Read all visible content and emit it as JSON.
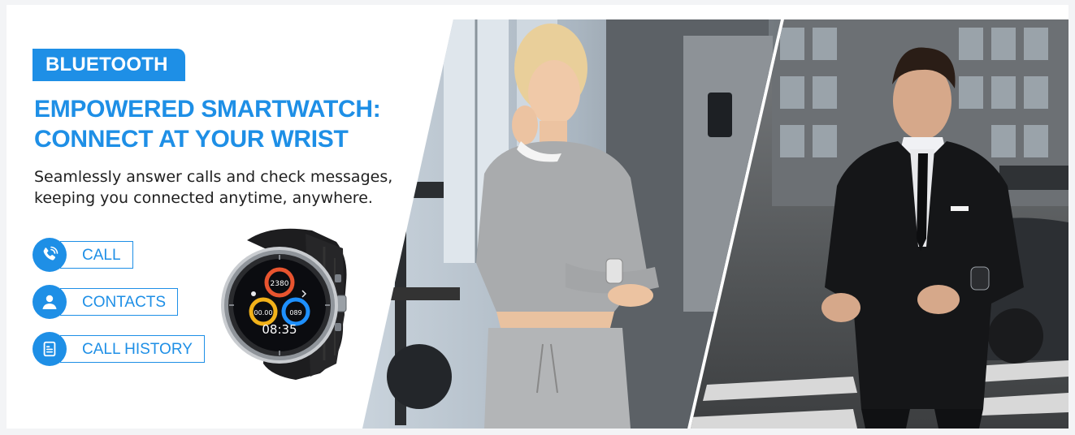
{
  "badge": {
    "label": "BLUETOOTH"
  },
  "headline": {
    "line1": "EMPOWERED SMARTWATCH:",
    "line2": "CONNECT AT YOUR WRIST"
  },
  "subtitle": {
    "line1": "Seamlessly answer calls and check messages,",
    "line2": "keeping you connected anytime, anywhere."
  },
  "features": [
    {
      "label": "CALL",
      "icon": "phone-icon"
    },
    {
      "label": "CONTACTS",
      "icon": "person-icon"
    },
    {
      "label": "CALL HISTORY",
      "icon": "document-icon"
    }
  ],
  "watch_face": {
    "steps": "2380",
    "heart": "089",
    "time": "08:35",
    "small": "00.00"
  },
  "colors": {
    "accent": "#1e8fe6",
    "text": "#1f1f1f"
  }
}
